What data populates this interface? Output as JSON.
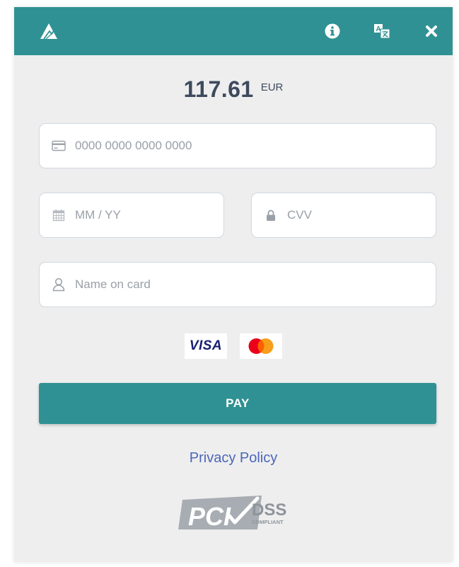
{
  "header": {
    "logo_icon": "mountain-logo-icon",
    "icons": [
      "info-icon",
      "translate-icon",
      "close-icon"
    ],
    "color": "#2f9193"
  },
  "payment": {
    "amount": "117.61",
    "currency": "EUR"
  },
  "form": {
    "card_number": {
      "placeholder": "0000 0000 0000 0000",
      "icon": "credit-card-icon"
    },
    "expiry": {
      "placeholder": "MM / YY",
      "icon": "calendar-icon"
    },
    "cvv": {
      "placeholder": "CVV",
      "icon": "lock-icon"
    },
    "name": {
      "placeholder": "Name on card",
      "icon": "user-icon"
    }
  },
  "card_brands": {
    "visa": "VISA",
    "mastercard_icon": "mastercard-icon"
  },
  "pay_button": {
    "label": "PAY",
    "color": "#2f9193"
  },
  "privacy_link": "Privacy Policy",
  "pci_badge": {
    "icon": "pci-dss-compliant-logo",
    "text_main": "PCI",
    "text_dss": "DSS",
    "text_compliant": "COMPLIANT"
  },
  "colors": {
    "background": "#eeeeef",
    "link": "#4b67b8",
    "amount_text": "#3e4a5c"
  }
}
